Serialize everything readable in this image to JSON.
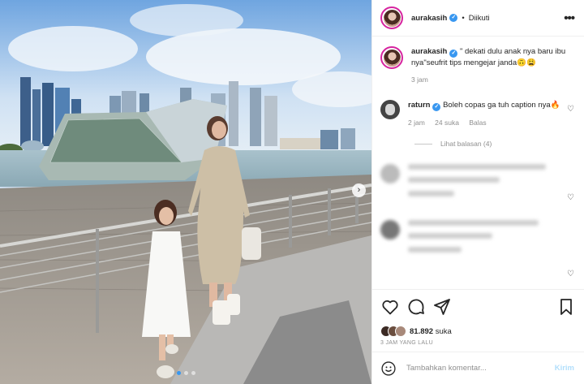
{
  "post": {
    "username": "aurakasih",
    "follow_status": "Diikuti",
    "separator": "•",
    "more_symbol": "•••"
  },
  "caption": {
    "username": "aurakasih",
    "text": "\" dekati dulu anak nya baru ibu nya\"seufrit tips mengejar janda🙃😩",
    "time": "3 jam"
  },
  "comments": [
    {
      "username": "raturn",
      "text": "Boleh copas ga tuh caption nya🔥",
      "time": "2 jam",
      "likes": "24 suka",
      "reply_label": "Balas",
      "view_replies": "Lihat balasan (4)"
    }
  ],
  "actions": {
    "like_icon": "heart-icon",
    "comment_icon": "comment-icon",
    "share_icon": "share-icon",
    "save_icon": "bookmark-icon"
  },
  "likes": {
    "count": "81.892",
    "label": "suka"
  },
  "time_ago": "3 JAM YANG LALU",
  "add_comment": {
    "placeholder": "Tambahkan komentar...",
    "post_label": "Kirim"
  },
  "carousel": {
    "current": 1,
    "total": 3,
    "next_symbol": "›"
  },
  "colors": {
    "accent": "#3897f0",
    "post_disabled": "#b2dffc",
    "muted": "#8e8e8e",
    "story_ring": "#d6249f"
  }
}
